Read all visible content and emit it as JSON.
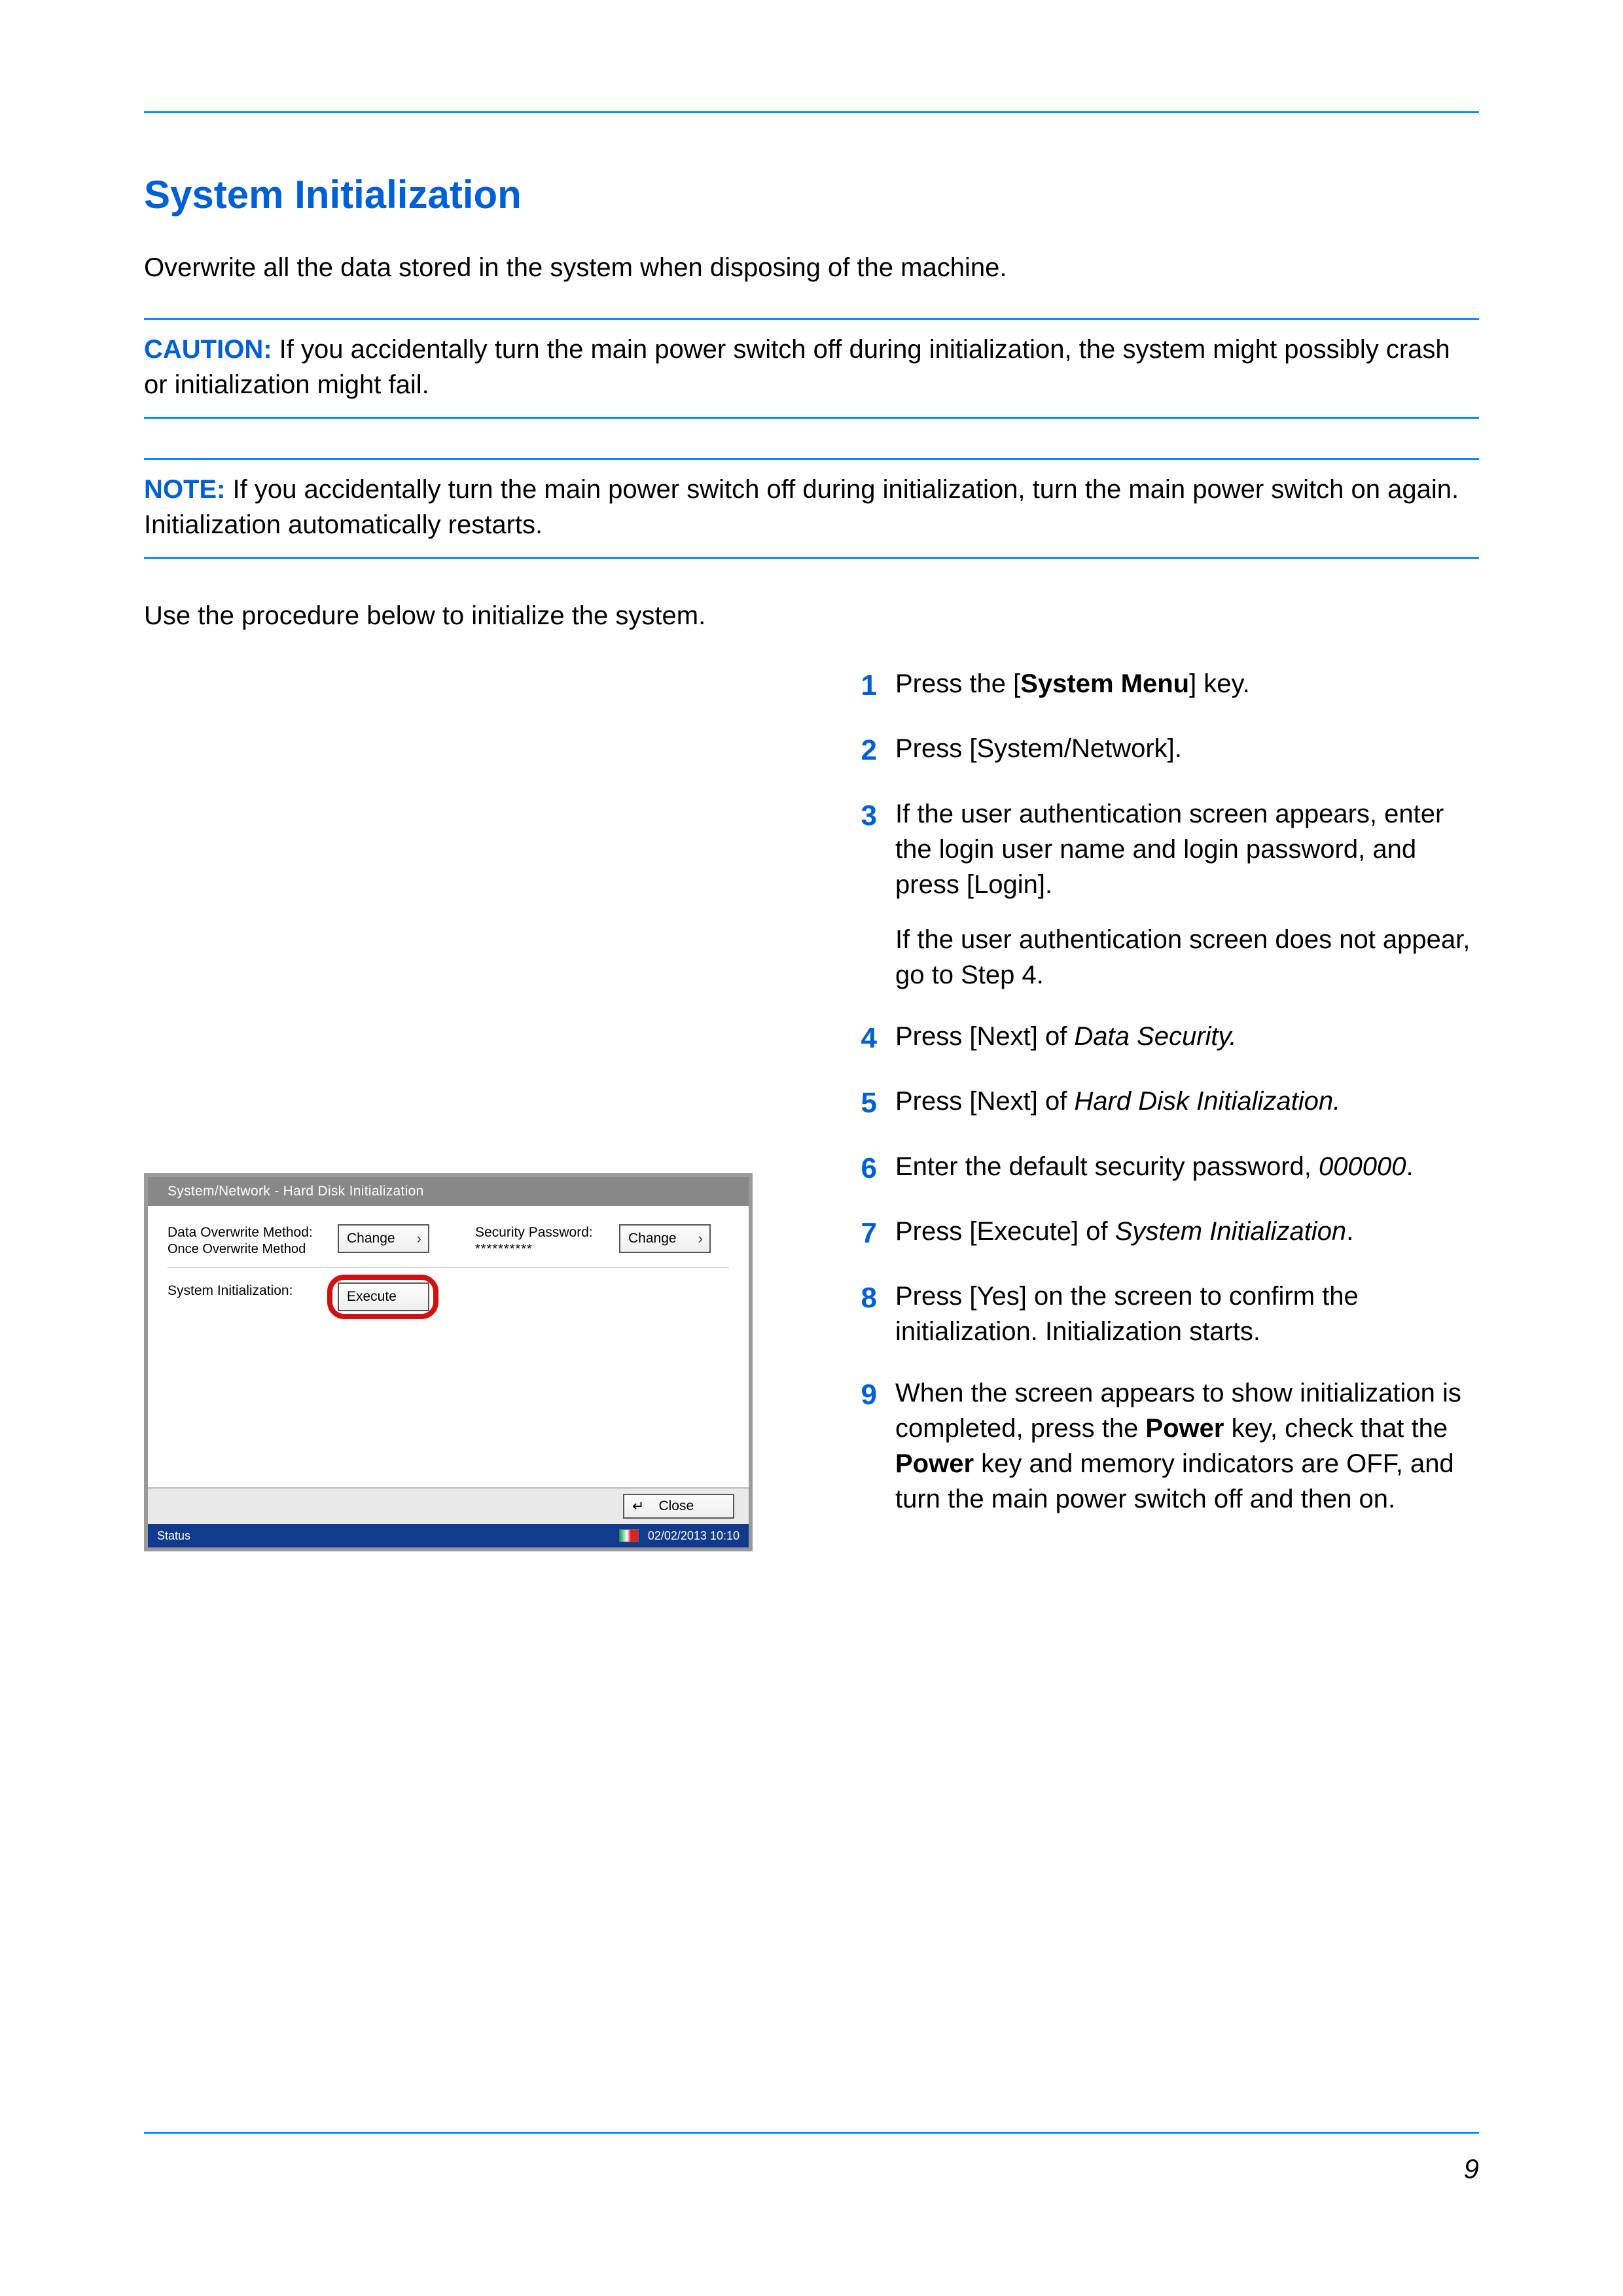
{
  "heading": "System Initialization",
  "intro": "Overwrite all the data stored in the system when disposing of the machine.",
  "caution": {
    "lead": "CAUTION:",
    "text": " If you accidentally turn the main power switch off during initialization, the system might possibly crash or initialization might fail."
  },
  "note": {
    "lead": "NOTE:",
    "text": " If you accidentally turn the main power switch off during initialization, turn the main power switch on again. Initialization automatically restarts."
  },
  "lead_in": "Use the procedure below to initialize the system.",
  "steps": {
    "s1_a": "Press the [",
    "s1_b": "System Menu",
    "s1_c": "] key.",
    "s2": "Press [System/Network].",
    "s3a": "If the user authentication screen appears, enter the login user name and login password, and press [Login].",
    "s3b": "If the user authentication screen does not appear, go to Step 4.",
    "s4_a": "Press [Next] of ",
    "s4_b": "Data Security.",
    "s5_a": "Press [Next] of ",
    "s5_b": "Hard Disk Initialization.",
    "s6_a": "Enter the default security password, ",
    "s6_b": "000000",
    "s6_c": ".",
    "s7_a": "Press [Execute] of ",
    "s7_b": "System Initialization",
    "s7_c": ".",
    "s8": "Press [Yes] on the screen to confirm the initialization. Initialization starts.",
    "s9_a": "When the screen appears to show initialization is completed, press the ",
    "s9_b": "Power",
    "s9_c": " key, check that the ",
    "s9_d": "Power",
    "s9_e": " key and memory indicators are OFF, and turn the main power switch off and then on."
  },
  "step_nums": {
    "n1": "1",
    "n2": "2",
    "n3": "3",
    "n4": "4",
    "n5": "5",
    "n6": "6",
    "n7": "7",
    "n8": "8",
    "n9": "9"
  },
  "panel": {
    "title": "System/Network - Hard Disk Initialization",
    "row1_label": "Data Overwrite Method:",
    "row1_value": "Once Overwrite Method",
    "change": "Change",
    "sec_label": "Security Password:",
    "sec_mask": "**********",
    "row2_label": "System Initialization:",
    "execute": "Execute",
    "close": "Close",
    "status": "Status",
    "datetime": "02/02/2013  10:10"
  },
  "page_number": "9",
  "glyphs": {
    "chevron": "›",
    "return": "↵"
  }
}
